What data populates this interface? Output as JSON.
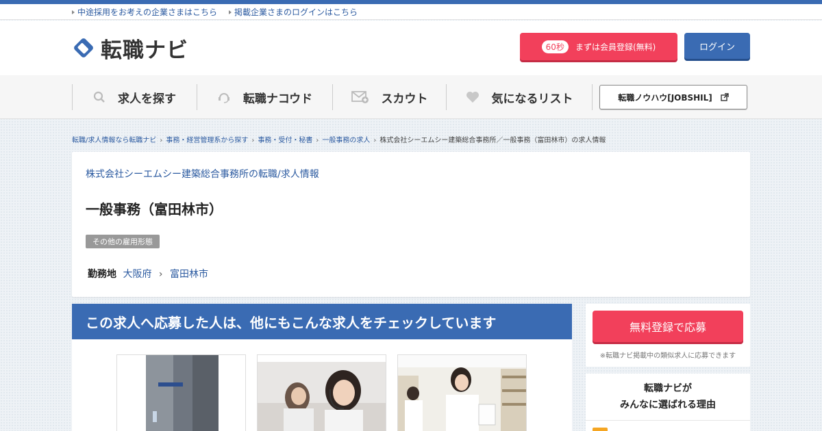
{
  "utility": {
    "link_employers": "中途採用をお考えの企業さまはこちら",
    "link_employer_login": "掲載企業さまのログインはこちら"
  },
  "header": {
    "logo_text": "転職ナビ",
    "register_badge": "60秒",
    "register_label": "まずは会員登録(無料)",
    "login_label": "ログイン"
  },
  "nav": {
    "items": [
      {
        "label": "求人を探す",
        "icon": "search-icon"
      },
      {
        "label": "転職ナコウド",
        "icon": "headset-icon"
      },
      {
        "label": "スカウト",
        "icon": "mail-plus-icon"
      },
      {
        "label": "気になるリスト",
        "icon": "heart-icon"
      }
    ],
    "jobshil_label": "転職ノウハウ[JOBSHIL]"
  },
  "breadcrumb": [
    "転職/求人情報なら転職ナビ",
    "事務・経営管理系から探す",
    "事務・受付・秘書",
    "一般事務の求人",
    "株式会社シーエムシー建築総合事務所／一般事務（富田林市）の求人情報"
  ],
  "job": {
    "company_link": "株式会社シーエムシー建築総合事務所の転職/求人情報",
    "title": "一般事務（富田林市）",
    "employment_tag": "その他の雇用形態",
    "location_label": "勤務地",
    "prefecture": "大阪府",
    "city": "富田林市"
  },
  "recommend": {
    "heading": "この求人へ応募した人は、他にもこんな求人をチェックしています"
  },
  "sidebar": {
    "apply_label": "無料登録で応募",
    "apply_note": "※転職ナビ掲載中の類似求人に応募できます",
    "why_line1": "転職ナビが",
    "why_line2": "みんなに選ばれる理由"
  },
  "colors": {
    "brand_blue": "#3a6bb3",
    "accent_red": "#f2405b",
    "link_blue": "#2b5aa0"
  }
}
